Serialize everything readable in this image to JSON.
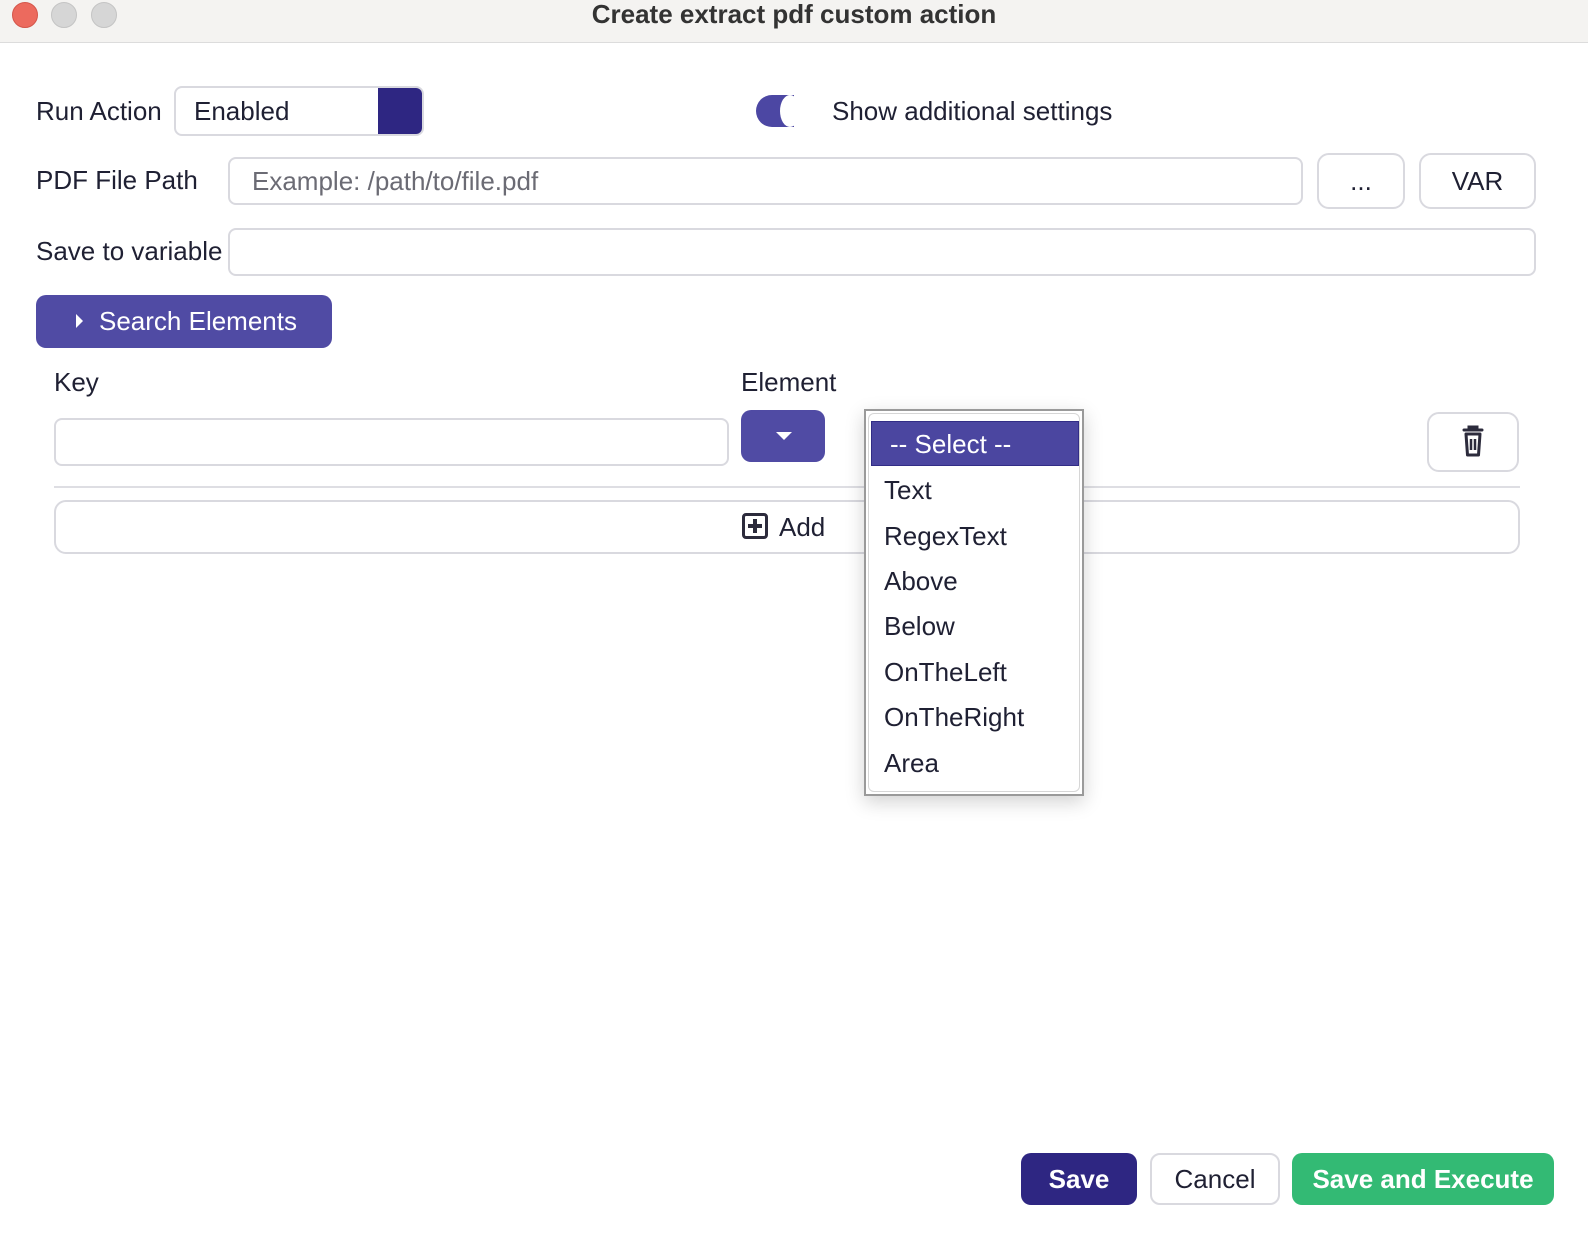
{
  "window": {
    "title": "Create extract pdf custom action"
  },
  "run_action": {
    "label": "Run Action",
    "value": "Enabled"
  },
  "additional_settings": {
    "label": "Show additional settings",
    "enabled": true
  },
  "pdf_path": {
    "label": "PDF File Path",
    "placeholder": "Example: /path/to/file.pdf",
    "browse_label": "...",
    "var_label": "VAR"
  },
  "save_to_variable": {
    "label": "Save to variable",
    "value": ""
  },
  "search_elements": {
    "label": "Search Elements"
  },
  "columns": {
    "key": "Key",
    "element": "Element"
  },
  "element_dropdown": {
    "options": [
      "-- Select --",
      "Text",
      "RegexText",
      "Above",
      "Below",
      "OnTheLeft",
      "OnTheRight",
      "Area"
    ],
    "selected": "-- Select --"
  },
  "add": {
    "label": "Add"
  },
  "footer": {
    "save": "Save",
    "cancel": "Cancel",
    "save_execute": "Save and Execute"
  },
  "colors": {
    "primary": "#2e2682",
    "accent": "#504ba4",
    "success": "#33ba74"
  }
}
